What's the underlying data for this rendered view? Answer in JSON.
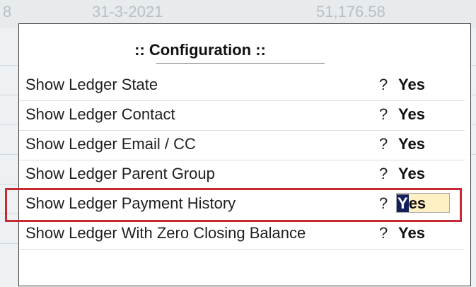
{
  "background": {
    "cells": [
      "8",
      "31-3-2021",
      "51,176.58"
    ]
  },
  "dialog": {
    "title": ":: Configuration ::",
    "rows": [
      {
        "label": "Show Ledger State",
        "question": "?",
        "value": "Yes"
      },
      {
        "label": "Show Ledger Contact",
        "question": "?",
        "value": "Yes"
      },
      {
        "label": "Show Ledger Email / CC",
        "question": "?",
        "value": "Yes"
      },
      {
        "label": "Show Ledger Parent Group",
        "question": "?",
        "value": "Yes"
      },
      {
        "label": "Show Ledger Payment History",
        "question": "?",
        "value": "Yes",
        "cursor_char": "Y",
        "rest": "es"
      },
      {
        "label": "Show Ledger With Zero Closing Balance",
        "question": "?",
        "value": "Yes"
      }
    ]
  },
  "colors": {
    "highlight_border": "#c72a35",
    "active_field_bg": "#fff0c4",
    "cursor_bg": "#14205b"
  }
}
